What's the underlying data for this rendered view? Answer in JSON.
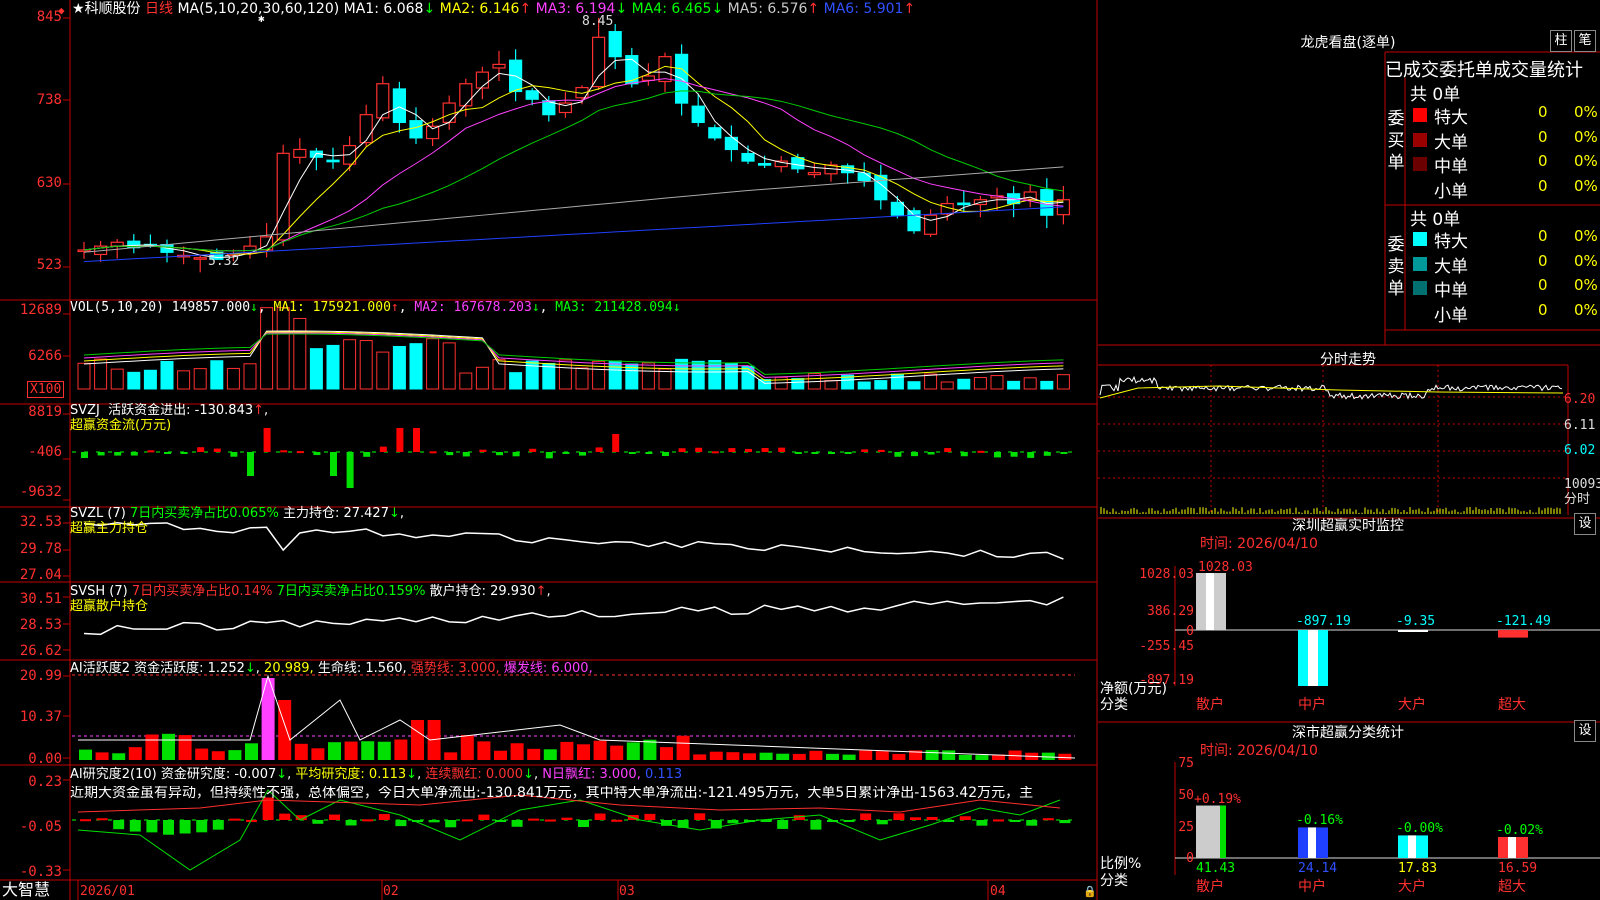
{
  "stock": {
    "name_star": "★",
    "name": "科顺股份",
    "period": "日线",
    "ma_label": "MA(5,10,20,30,60,120)",
    "ma": [
      {
        "k": "MA1:",
        "v": "6.068",
        "a": "↓",
        "c": "#ffffff"
      },
      {
        "k": "MA2:",
        "v": "6.146",
        "a": "↑",
        "c": "#ffff00"
      },
      {
        "k": "MA3:",
        "v": "6.194",
        "a": "↓",
        "c": "#ff40ff"
      },
      {
        "k": "MA4:",
        "v": "6.465",
        "a": "↓",
        "c": "#00ff00"
      },
      {
        "k": "MA5:",
        "v": "6.576",
        "a": "↑",
        "c": "#c8c8c8"
      },
      {
        "k": "MA6:",
        "v": "5.901",
        "a": "↑",
        "c": "#3050ff"
      }
    ],
    "high_mark": "8.45",
    "low_mark": "5.32",
    "star_mark": "✱"
  },
  "price_axis": [
    "845",
    "738",
    "630",
    "523"
  ],
  "vol": {
    "label": "VOL(5,10,20)",
    "val": "149857.000",
    "va": "↓",
    "ma1": "MA1: 175921.000",
    "ma1a": "↑",
    "ma2": "MA2: 167678.203",
    "ma2a": "↓",
    "ma3": "MA3: 211428.094",
    "ma3a": "↓",
    "axis": [
      "12689",
      "6266"
    ],
    "unit": "X100"
  },
  "svzj": {
    "label": "SVZJ",
    "text": "活跃资金进出: -130.843",
    "arrow": "↑",
    "sub": "超赢资金流(万元)",
    "axis": [
      "8819",
      "-406",
      "-9632"
    ]
  },
  "svzl": {
    "label": "SVZL (7)",
    "t1": "7日内买卖净占比0.065%",
    "t2": "主力持仓: 27.427",
    "a": "↓",
    "sub": "超赢主力持仓",
    "axis": [
      "32.53",
      "29.78",
      "27.04"
    ]
  },
  "svsh": {
    "label": "SVSH (7)",
    "t1": "7日内买卖净占比0.14%",
    "t2": "7日内买卖净占比0.159%",
    "t3": "散户持仓: 29.930",
    "a": "↑",
    "sub": "超赢散户持仓",
    "axis": [
      "30.51",
      "28.53",
      "26.62"
    ]
  },
  "ai1": {
    "label": "AI活跃度2",
    "t1": "资金活跃度: 1.252",
    "a1": "↓",
    "t2": "20.989,",
    "t3": "生命线: 1.560,",
    "t4": "强势线: 3.000,",
    "t5": "爆发线: 6.000,",
    "axis": [
      "20.99",
      "10.37",
      "0.00"
    ]
  },
  "ai2": {
    "label": "AI研究度2(10)",
    "t1": "资金研究度: -0.007",
    "a1": "↓",
    "t2": "平均研究度: 0.113",
    "a2": "↓",
    "t3": "连续飘红: 0.000",
    "a3": "↓",
    "t4": "N日飘红: 3.000,",
    "t5": "0.113",
    "axis": [
      "0.23",
      "-0.05",
      "-0.33"
    ],
    "comment": "近期大资金虽有异动，但持续性不强，总体偏空，今日大单净流出:-130.841万元，其中特大单净流出:-121.495万元，大单5日累计净出-1563.42万元，主"
  },
  "xaxis": {
    "brand": "大智慧",
    "labels": [
      "2026/01",
      "02",
      "03",
      "04"
    ]
  },
  "lhb": {
    "title": "龙虎看盘(逐单)",
    "btn1": "柱",
    "btn2": "笔",
    "header": "已成交委托单成交量统计",
    "buy": {
      "side": "委买单",
      "total": "共 0单",
      "rows": [
        {
          "n": "特大",
          "v": "0",
          "p": "0%",
          "c": "#ff0000"
        },
        {
          "n": "大单",
          "v": "0",
          "p": "0%",
          "c": "#9a0000"
        },
        {
          "n": "中单",
          "v": "0",
          "p": "0%",
          "c": "#6a0000"
        },
        {
          "n": "小单",
          "v": "0",
          "p": "0%",
          "c": "#000000"
        }
      ]
    },
    "sell": {
      "side": "委卖单",
      "total": "共 0单",
      "rows": [
        {
          "n": "特大",
          "v": "0",
          "p": "0%",
          "c": "#00ffff"
        },
        {
          "n": "大单",
          "v": "0",
          "p": "0%",
          "c": "#009a9a"
        },
        {
          "n": "中单",
          "v": "0",
          "p": "0%",
          "c": "#007070"
        },
        {
          "n": "小单",
          "v": "0",
          "p": "0%",
          "c": "#000000"
        }
      ]
    }
  },
  "intraday": {
    "title": "分时走势",
    "axis": [
      "6.20",
      "6.11",
      "6.02"
    ],
    "vol": "10093",
    "unit": "分时"
  },
  "monitor": {
    "title": "深圳超赢实时监控",
    "btn": "设",
    "time": "时间: 2026/04/10",
    "axis": [
      "1028.03",
      "386.29",
      "0",
      "-255.45",
      "-897.19"
    ],
    "ylabel": "净额(万元)",
    "xlabel": "分类",
    "chart_data": {
      "type": "bar",
      "categories": [
        "散户",
        "中户",
        "大户",
        "超大"
      ],
      "values": [
        1028.03,
        -897.19,
        -9.35,
        -121.49
      ],
      "labels": [
        "1028.03",
        "-897.19",
        "-9.35",
        "-121.49"
      ]
    }
  },
  "classify": {
    "title": "深市超赢分类统计",
    "btn": "设",
    "time": "时间: 2026/04/10",
    "axis": [
      "75",
      "50",
      "25",
      "0"
    ],
    "ylabel": "比例%",
    "xlabel": "分类",
    "chart_data": {
      "type": "bar",
      "categories": [
        "散户",
        "中户",
        "大户",
        "超大"
      ],
      "values": [
        41.43,
        24.14,
        17.83,
        16.59
      ],
      "changes": [
        "+0.19%",
        "-0.16%",
        "-0.00%",
        "-0.02%"
      ],
      "labels": [
        "41.43",
        "24.14",
        "17.83",
        "16.59"
      ]
    }
  }
}
